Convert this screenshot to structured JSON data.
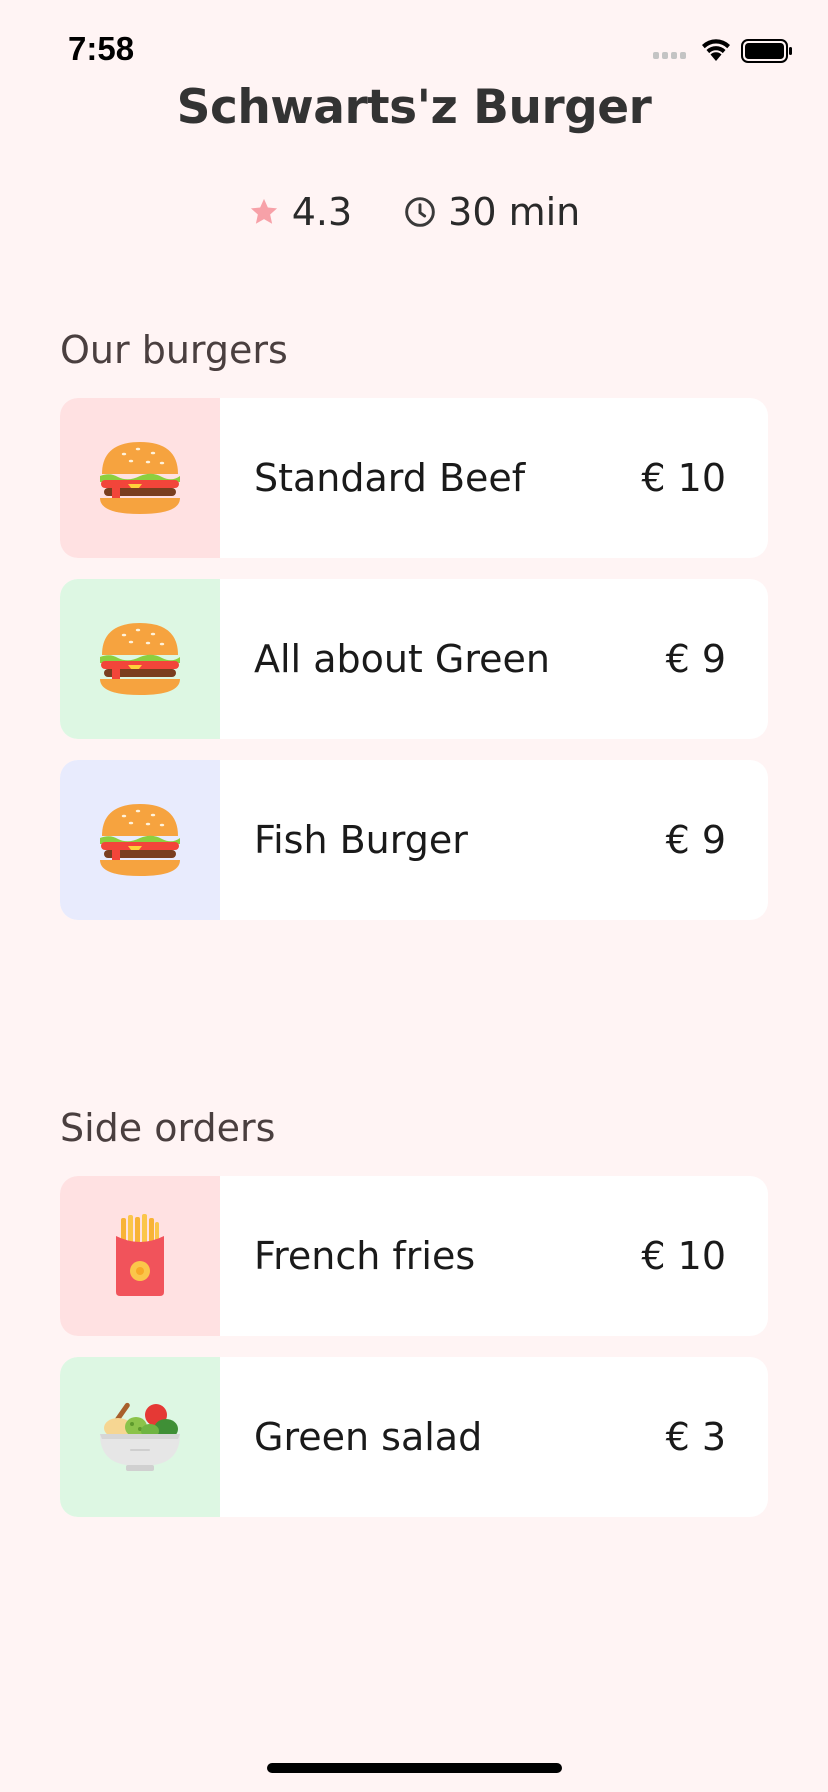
{
  "status_bar": {
    "time": "7:58",
    "icons": [
      "cellular-signal-icon",
      "wifi-icon",
      "battery-icon"
    ]
  },
  "restaurant": {
    "name": "Schwarts'z Burger",
    "rating": "4.3",
    "delivery_time": "30 min",
    "rating_icon": "star-icon",
    "time_icon": "clock-icon"
  },
  "sections": {
    "burgers": {
      "title": "Our burgers",
      "items": [
        {
          "name": "Standard Beef",
          "price": "€ 10",
          "icon": "burger-icon",
          "bg": "#ffe1e2"
        },
        {
          "name": "All about Green",
          "price": "€ 9",
          "icon": "burger-icon",
          "bg": "#ddf7e3"
        },
        {
          "name": "Fish Burger",
          "price": "€ 9",
          "icon": "burger-icon",
          "bg": "#e8ebfd"
        }
      ]
    },
    "sides": {
      "title": "Side orders",
      "items": [
        {
          "name": "French fries",
          "price": "€ 10",
          "icon": "fries-icon",
          "bg": "#ffe1e2"
        },
        {
          "name": "Green salad",
          "price": "€ 3",
          "icon": "salad-icon",
          "bg": "#ddf7e3"
        }
      ]
    }
  },
  "colors": {
    "background": "#fff4f4",
    "card": "#ffffff",
    "star": "#f7a1a8"
  }
}
